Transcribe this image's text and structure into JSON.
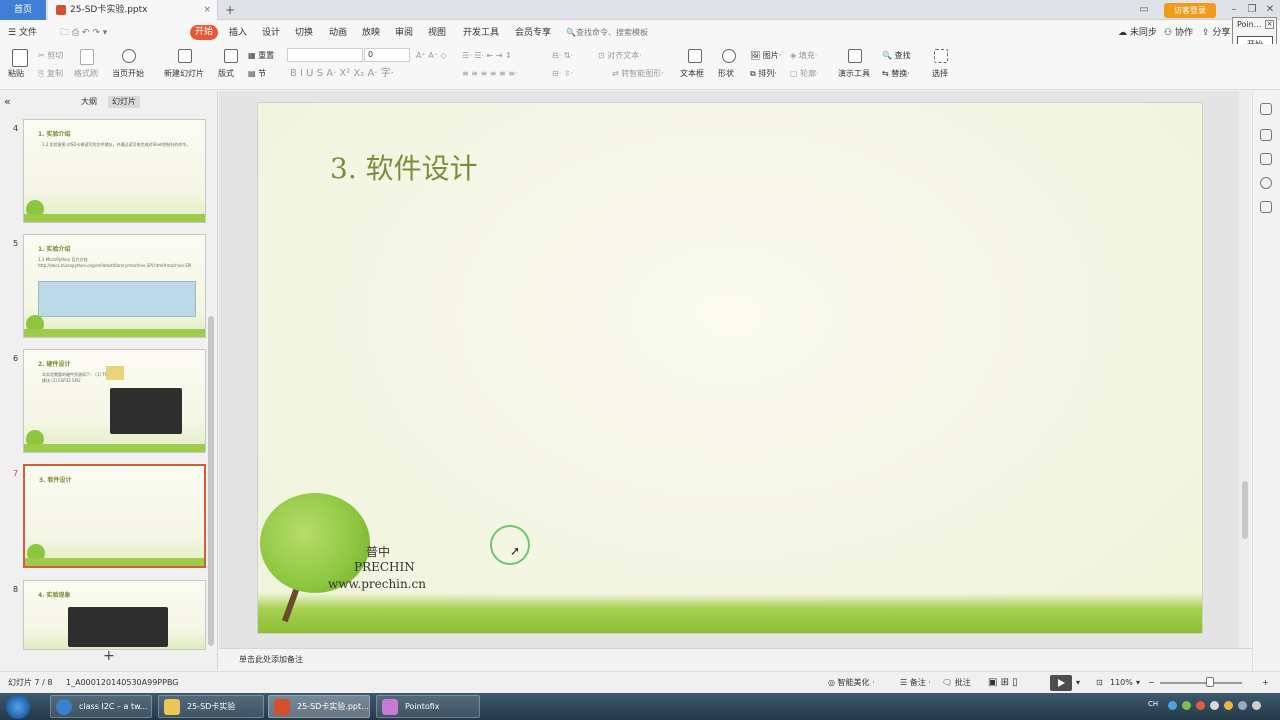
{
  "tabbar": {
    "home": "首页",
    "doc_title": "25-SD卡实验.pptx",
    "close": "×",
    "add": "+",
    "guest_login": "访客登录"
  },
  "menubar": {
    "file": "文件",
    "start_badge": "开始",
    "items": [
      "插入",
      "设计",
      "切换",
      "动画",
      "放映",
      "审阅",
      "视图",
      "开发工具",
      "会员专享"
    ],
    "search_placeholder": "查找命令、搜索模板",
    "unsync": "未同步",
    "collab": "协作",
    "share": "分享"
  },
  "popup": {
    "title": "Poin...",
    "close": "×",
    "button": "开始"
  },
  "toolbar": {
    "paste": "粘贴",
    "cut": "剪切",
    "copy": "复制",
    "format_painter": "格式刷",
    "from_current": "当页开始",
    "new_slide": "新建幻灯片",
    "layout": "版式",
    "section": "节",
    "reset": "重置",
    "font_size": "0",
    "align_text": "对齐文本",
    "smartart": "转智能图形",
    "textbox": "文本框",
    "shape": "形状",
    "picture": "图片",
    "fill": "填充",
    "arrange": "排列",
    "outline": "轮廓",
    "present_tools": "演示工具",
    "find": "查找",
    "replace": "替换",
    "select": "选择"
  },
  "leftpanel": {
    "collapse": "«",
    "tab_outline": "大纲",
    "tab_slides": "幻灯片",
    "add_slide": "+",
    "slides": [
      {
        "num": "4",
        "title": "1. 实验介绍",
        "text": "1.2 实验意图 对SD卡做读写的文件储存，并通过读写来完成对Shell控制台的命令。"
      },
      {
        "num": "5",
        "title": "1. 实验介绍",
        "text": "1.3 MicroPython 官方文档 http://docs.micropython.org/en/latest/library/machine.SPI.html#machine.SPI"
      },
      {
        "num": "6",
        "title": "2. 硬件设计",
        "text": "本实验需要的硬件资源如下： (1) TF卡模块 (2) ESP32 SPI2"
      },
      {
        "num": "7",
        "title": "3. 软件设计",
        "text": ""
      },
      {
        "num": "8",
        "title": "4. 实验现象",
        "text": ""
      }
    ]
  },
  "slide": {
    "title": "3. 软件设计",
    "logo_cn": "普中",
    "logo_en": "PRECHIN",
    "logo_url": "www.prechin.cn"
  },
  "notes": {
    "placeholder": "单击此处添加备注"
  },
  "statusbar": {
    "slide_pos": "幻灯片 7 / 8",
    "theme": "1_A000120140530A99PPBG",
    "beautify": "智能美化",
    "notes": "备注",
    "comments": "批注",
    "zoom": "110%",
    "zoom_minus": "−",
    "zoom_plus": "+"
  },
  "taskbar": {
    "items": [
      "class I2C – a tw...",
      "25-SD卡实验",
      "25-SD卡实验.ppt...",
      "Pointofix"
    ],
    "tray_lang": "CH"
  },
  "colors": {
    "accent_blue": "#3f7fd5",
    "start_red": "#e8593a",
    "guest_orange": "#f09b1b",
    "slide_title": "#7e8c3a",
    "active_thumb": "#d75b35"
  }
}
